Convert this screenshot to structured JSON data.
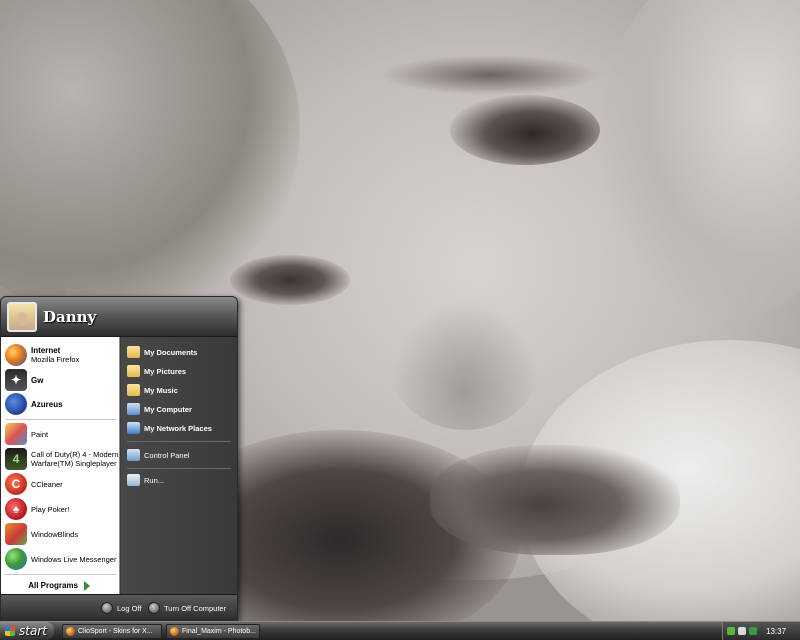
{
  "desktop": {
    "wallpaper": "monochrome portrait photo"
  },
  "start_menu": {
    "user_name": "Danny",
    "pinned": [
      {
        "label": "Internet",
        "sublabel": "Mozilla Firefox",
        "icon": "firefox-icon"
      },
      {
        "label": "Gw",
        "icon": "gw-icon"
      },
      {
        "label": "Azureus",
        "icon": "azureus-frog-icon"
      }
    ],
    "recent": [
      {
        "label": "Paint",
        "icon": "paint-icon"
      },
      {
        "label": "Call of Duty(R) 4 - Modern",
        "label2": "Warfare(TM) Singleplayer",
        "icon": "cod4-icon"
      },
      {
        "label": "CCleaner",
        "icon": "ccleaner-icon"
      },
      {
        "label": "Play Poker!",
        "icon": "poker-icon"
      },
      {
        "label": "WindowBlinds",
        "icon": "windowblinds-icon"
      },
      {
        "label": "Windows Live Messenger",
        "icon": "messenger-icon"
      }
    ],
    "all_programs": "All Programs",
    "places": [
      {
        "label": "My Documents",
        "icon": "folder-documents-icon"
      },
      {
        "label": "My Pictures",
        "icon": "folder-pictures-icon"
      },
      {
        "label": "My Music",
        "icon": "folder-music-icon"
      },
      {
        "label": "My Computer",
        "icon": "computer-icon"
      },
      {
        "label": "My Network Places",
        "icon": "network-icon"
      }
    ],
    "tools": [
      {
        "label": "Control Panel",
        "icon": "control-panel-icon"
      },
      {
        "label": "Run...",
        "icon": "run-icon"
      }
    ],
    "log_off": "Log Off",
    "turn_off": "Turn Off Computer"
  },
  "taskbar": {
    "start_label": "start",
    "tasks": [
      {
        "label": "ClioSport - Skins for X..."
      },
      {
        "label": "Final_Maxim - Photob..."
      }
    ],
    "clock": "13:37"
  },
  "colors": {
    "menu_dark": "#3b3b3b",
    "left_pane": "#ffffff",
    "taskbar": "#3c3c3c"
  }
}
